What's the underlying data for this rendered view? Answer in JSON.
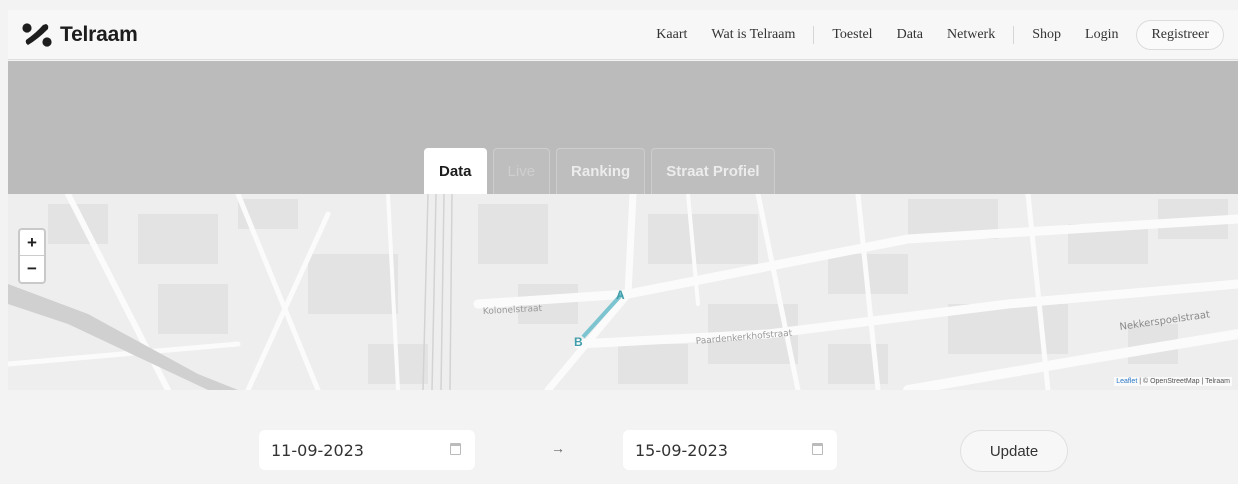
{
  "brand": {
    "name": "Telraam",
    "logo_icon": "telraam-logo-icon"
  },
  "nav": {
    "items": [
      "Kaart",
      "Wat is Telraam",
      "Toestel",
      "Data",
      "Netwerk",
      "Shop",
      "Login"
    ],
    "register": "Registreer"
  },
  "tabs": [
    {
      "label": "Data",
      "state": "active"
    },
    {
      "label": "Live",
      "state": "disabled"
    },
    {
      "label": "Ranking",
      "state": "inactive"
    },
    {
      "label": "Straat Profiel",
      "state": "inactive"
    }
  ],
  "map": {
    "zoom_in": "+",
    "zoom_out": "−",
    "markers": {
      "a": "A",
      "b": "B"
    },
    "streets": [
      "Nekkerspoelstraat",
      "Paardenkerkhofstraat",
      "Kolonelstraat"
    ],
    "attribution": {
      "leaflet": "Leaflet",
      "rest": " | © OpenStreetMap | Telraam"
    },
    "segment_color": "#7cc4cf"
  },
  "dates": {
    "from": "11-09-2023",
    "to": "15-09-2023",
    "arrow": "→",
    "calendar_icon": "calendar-icon"
  },
  "update_label": "Update"
}
